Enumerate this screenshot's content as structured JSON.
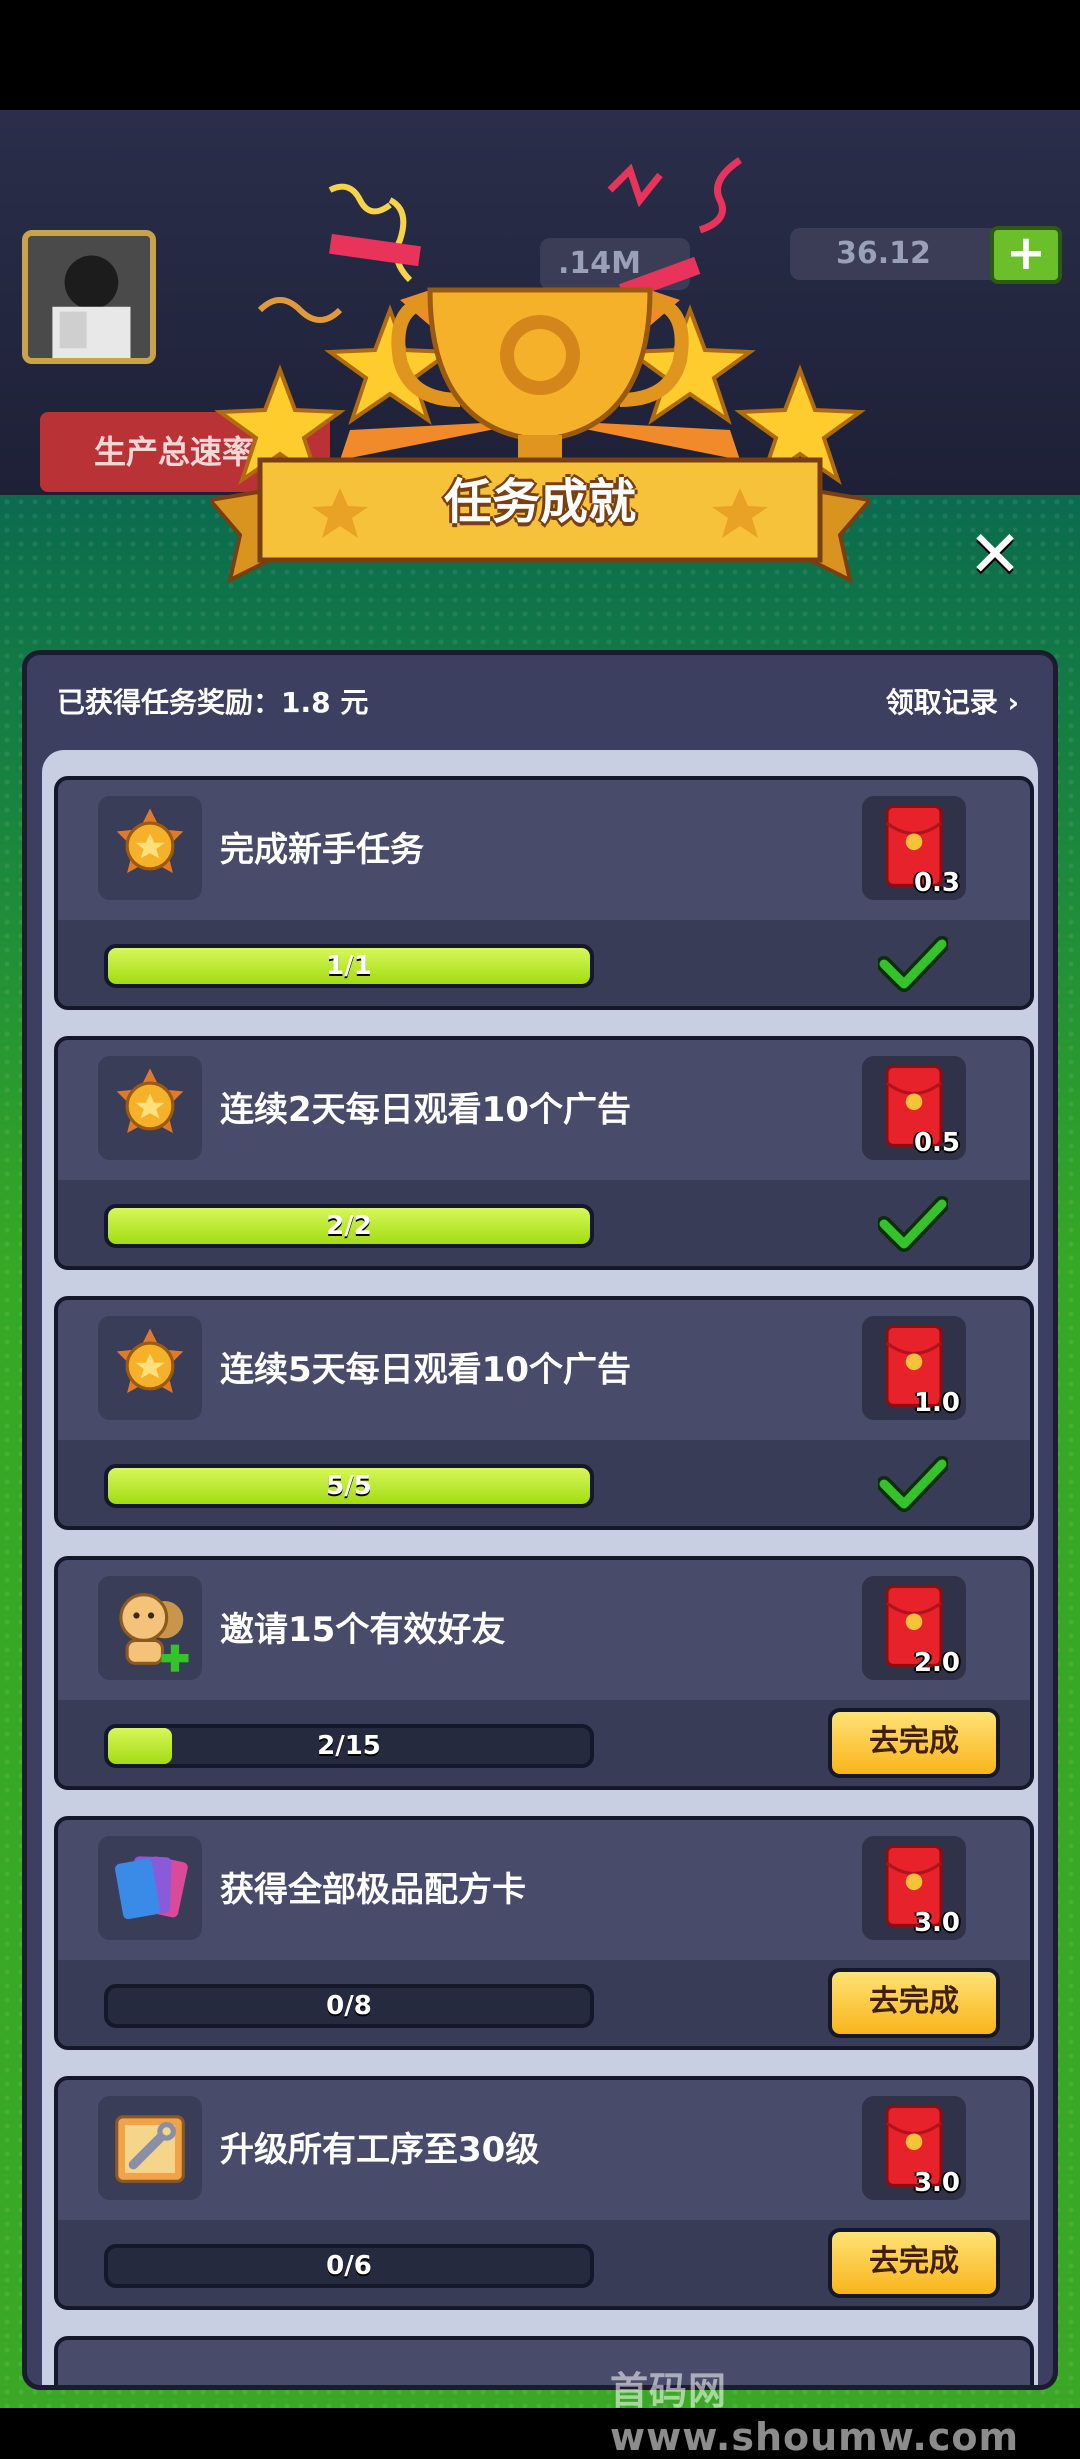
{
  "header": {
    "resource1": ".14M",
    "coins": "36.12",
    "speed_tab": "生产总速率"
  },
  "dialog": {
    "title": "任务成就",
    "reward_earned": "已获得任务奖励：1.8 元",
    "record_link": "领取记录 ›"
  },
  "tasks": [
    {
      "name": "完成新手任务",
      "reward": "0.3",
      "progress_text": "1/1",
      "progress": 1.0,
      "status": "done"
    },
    {
      "name": "连续2天每日观看10个广告",
      "reward": "0.5",
      "progress_text": "2/2",
      "progress": 1.0,
      "status": "done"
    },
    {
      "name": "连续5天每日观看10个广告",
      "reward": "1.0",
      "progress_text": "5/5",
      "progress": 1.0,
      "status": "done"
    },
    {
      "name": "邀请15个有效好友",
      "reward": "2.0",
      "progress_text": "2/15",
      "progress": 0.133,
      "status": "go",
      "button": "去完成"
    },
    {
      "name": "获得全部极品配方卡",
      "reward": "3.0",
      "progress_text": "0/8",
      "progress": 0,
      "status": "go",
      "button": "去完成"
    },
    {
      "name": "升级所有工序至30级",
      "reward": "3.0",
      "progress_text": "0/6",
      "progress": 0,
      "status": "go",
      "button": "去完成"
    }
  ],
  "watermark": "首码网www.shoumw.com",
  "colors": {
    "accent_green": "#a2dc12",
    "button_yellow": "#f8b51a",
    "panel": "#3c3f5f"
  }
}
